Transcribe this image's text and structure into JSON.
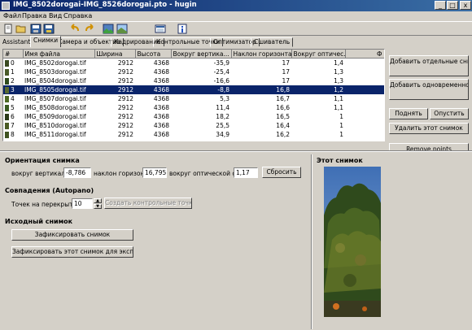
{
  "window": {
    "title": "IMG_8502dorogai-IMG_8526dorogai.pto - hugin",
    "min_label": "_",
    "max_label": "□",
    "close_label": "x"
  },
  "menu": [
    "Файл",
    "Правка",
    "Вид",
    "Справка"
  ],
  "tabs": {
    "prefix": "Assistant",
    "items": [
      "Снимки",
      "Камера и объектив",
      "Кадрирование",
      "Контрольные точки",
      "Оптимизатор",
      "Сшиватель"
    ],
    "active_index": 0
  },
  "table": {
    "columns": [
      "#",
      "Имя файла",
      "Ширина",
      "Высота",
      "Вокруг вертика...",
      "Наклон горизонта (р)",
      "Вокруг оптичес...",
      "Ф"
    ],
    "rows": [
      {
        "n": "0",
        "file": "IMG_8502dorogai.tif",
        "w": "2912",
        "h": "4368",
        "yaw": "-35,9",
        "pitch": "17",
        "roll": "1,4"
      },
      {
        "n": "1",
        "file": "IMG_8503dorogai.tif",
        "w": "2912",
        "h": "4368",
        "yaw": "-25,4",
        "pitch": "17",
        "roll": "1,3"
      },
      {
        "n": "2",
        "file": "IMG_8504dorogai.tif",
        "w": "2912",
        "h": "4368",
        "yaw": "-16,6",
        "pitch": "17",
        "roll": "1,3"
      },
      {
        "n": "3",
        "file": "IMG_8505dorogai.tif",
        "w": "2912",
        "h": "4368",
        "yaw": "-8,8",
        "pitch": "16,8",
        "roll": "1,2"
      },
      {
        "n": "4",
        "file": "IMG_8507dorogai.tif",
        "w": "2912",
        "h": "4368",
        "yaw": "5,3",
        "pitch": "16,7",
        "roll": "1,1"
      },
      {
        "n": "5",
        "file": "IMG_8508dorogai.tif",
        "w": "2912",
        "h": "4368",
        "yaw": "11,4",
        "pitch": "16,6",
        "roll": "1,1"
      },
      {
        "n": "6",
        "file": "IMG_8509dorogai.tif",
        "w": "2912",
        "h": "4368",
        "yaw": "18,2",
        "pitch": "16,5",
        "roll": "1"
      },
      {
        "n": "7",
        "file": "IMG_8510dorogai.tif",
        "w": "2912",
        "h": "4368",
        "yaw": "25,5",
        "pitch": "16,4",
        "roll": "1"
      },
      {
        "n": "8",
        "file": "IMG_8511dorogai.tif",
        "w": "2912",
        "h": "4368",
        "yaw": "34,9",
        "pitch": "16,2",
        "roll": "1"
      }
    ],
    "selected_index": 3
  },
  "side_buttons": {
    "add_single": "Добавить отдельные снимки...",
    "add_timed": "Добавить одновременно сделанные снимки...",
    "move_up": "Поднять",
    "move_down": "Опустить",
    "remove": "Удалить этот снимок",
    "remove_points": "Remove points"
  },
  "orientation": {
    "heading": "Ориентация снимка",
    "yaw_label": "вокруг вертикали:",
    "yaw_value": "-8,786",
    "pitch_label": "наклон горизонта:",
    "pitch_value": "16,795",
    "roll_label": "вокруг оптической оси:",
    "roll_value": "1,17",
    "reset_button": "Сбросить"
  },
  "matching": {
    "heading": "Совпадения (Autopano)",
    "points_label": "Точек на перекрытие:",
    "points_value": "10",
    "create_button": "Создать контрольные точки"
  },
  "anchor": {
    "heading": "Исходный снимок",
    "anchor_position": "Зафиксировать снимок",
    "anchor_exposure": "Зафиксировать этот снимок для экспозиции"
  },
  "preview": {
    "heading": "Этот снимок"
  },
  "icons": [
    "new-file-icon",
    "open-folder-icon",
    "save-icon",
    "save-as-icon",
    "undo-icon",
    "redo-icon",
    "add-images-icon",
    "preview-icon",
    "fast-preview-icon",
    "info-icon"
  ]
}
